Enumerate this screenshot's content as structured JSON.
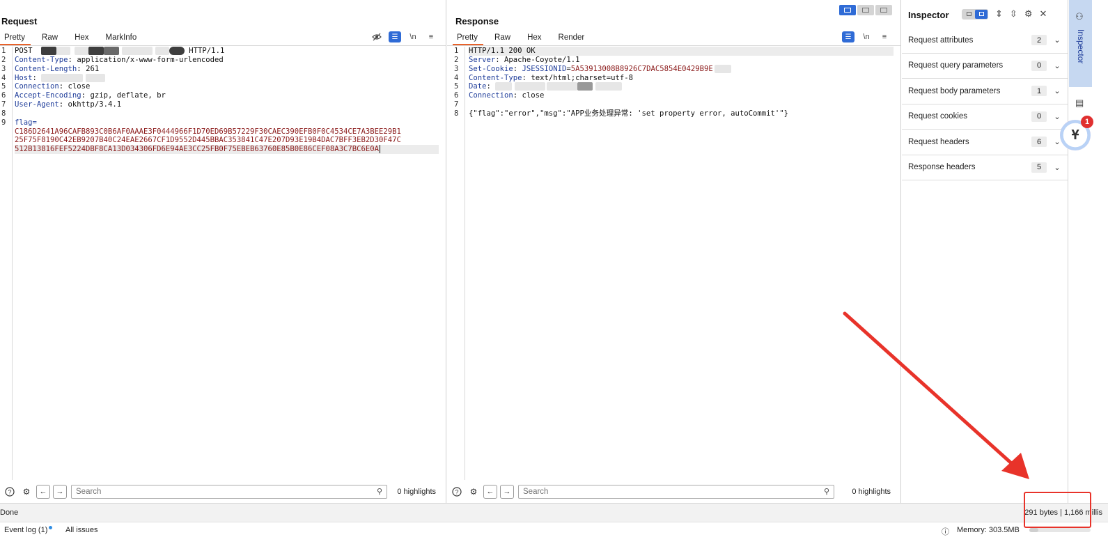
{
  "request": {
    "title": "Request",
    "tabs": [
      "Pretty",
      "Raw",
      "Hex",
      "MarkInfo"
    ],
    "active_tab": 0,
    "line_numbers": [
      "1",
      "2",
      "3",
      "4",
      "5",
      "6",
      "7",
      "8",
      "9"
    ],
    "lines": {
      "l1_method": "POST",
      "l1_proto": "HTTP/1.1",
      "l2_key": "Content-Type",
      "l2_val": "application/x-www-form-urlencoded",
      "l3_key": "Content-Length",
      "l3_val": "261",
      "l4_key": "Host",
      "l5_key": "Connection",
      "l5_val": "close",
      "l6_key": "Accept-Encoding",
      "l6_val": "gzip, deflate, br",
      "l7_key": "User-Agent",
      "l7_val": "okhttp/3.4.1",
      "l9_param": "flag=",
      "flag_1": "C186D2641A96CAFB893C0B6AF0AAAE3F0444966F1D70ED69B57229F30CAEC390EFB0F0C4534CE7A3BEE29B1",
      "flag_2": "25F75F8190C42EB9207B40C24EAE2667CF1D9552D445BBAC353841C47E207D93E19B4DAC7BFF3EB2D30F47C",
      "flag_3": "512B13816FEF5224DBF8CA13D034306FD6E94AE3CC25FB0F75EBEB63760E85B0E86CEF08A3C7BC6E0A"
    },
    "search_placeholder": "Search",
    "highlights": "0 highlights"
  },
  "response": {
    "title": "Response",
    "tabs": [
      "Pretty",
      "Raw",
      "Hex",
      "Render"
    ],
    "active_tab": 0,
    "line_numbers": [
      "1",
      "2",
      "3",
      "4",
      "5",
      "6",
      "7",
      "8"
    ],
    "lines": {
      "l1": "HTTP/1.1 200 OK",
      "l2_key": "Server",
      "l2_val": "Apache-Coyote/1.1",
      "l3_key": "Set-Cookie",
      "l3_name": "JSESSIONID",
      "l3_val": "5A53913008B8926C7DAC5854E0429B9E",
      "l4_key": "Content-Type",
      "l4_val": "text/html;charset=utf-8",
      "l5_key": "Date",
      "l6_key": "Connection",
      "l6_val": "close",
      "l8": "{\"flag\":\"error\",\"msg\":\"APP业务处理异常: 'set property error, autoCommit'\"}"
    },
    "search_placeholder": "Search",
    "highlights": "0 highlights"
  },
  "inspector": {
    "title": "Inspector",
    "sections": [
      {
        "label": "Request attributes",
        "count": "2"
      },
      {
        "label": "Request query parameters",
        "count": "0"
      },
      {
        "label": "Request body parameters",
        "count": "1"
      },
      {
        "label": "Request cookies",
        "count": "0"
      },
      {
        "label": "Request headers",
        "count": "6"
      },
      {
        "label": "Response headers",
        "count": "5"
      }
    ]
  },
  "rail": {
    "inspector_label": "Inspector",
    "notification_count": "1"
  },
  "status": {
    "left": "Done",
    "right": "291 bytes | 1,166 millis"
  },
  "bottom": {
    "event_log": "Event log (1)",
    "all_issues": "All issues",
    "memory": "Memory: 303.5MB",
    "memory_fraction": 0.15
  },
  "colors": {
    "accent": "#e8622a",
    "blue": "#2f6bd6",
    "annotation": "#e8332a",
    "key": "#1f3d9a",
    "value": "#8b1a1a"
  }
}
